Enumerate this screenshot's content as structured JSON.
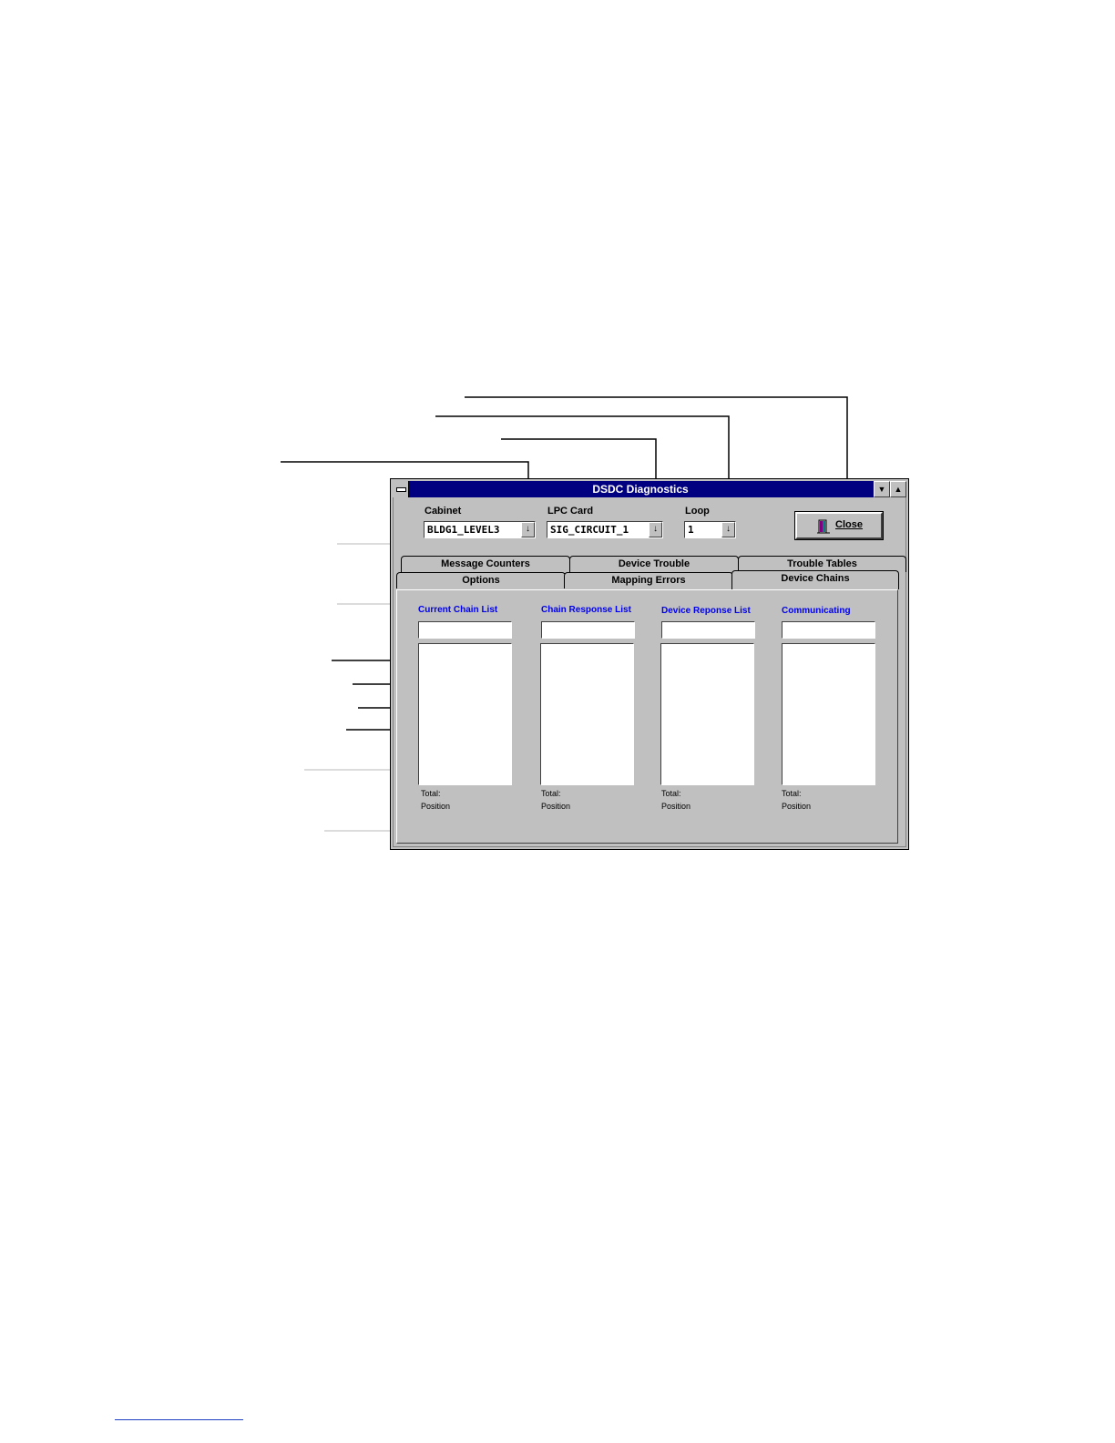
{
  "window": {
    "title": "DSDC Diagnostics",
    "min_glyph": "▼",
    "max_glyph": "▲"
  },
  "selectors": [
    {
      "label": "Cabinet",
      "value": "BLDG1_LEVEL3"
    },
    {
      "label": "LPC Card",
      "value": "SIG_CIRCUIT_1"
    },
    {
      "label": "Loop",
      "value": "1"
    }
  ],
  "dropdown_glyph": "↓",
  "close_button": {
    "label": "Close"
  },
  "tabs": {
    "row1": [
      "Message Counters",
      "Device Trouble",
      "Trouble Tables"
    ],
    "row2": [
      "Options",
      "Mapping Errors",
      "Device Chains"
    ],
    "active": "Device Chains"
  },
  "columns": [
    {
      "header": "Current Chain List",
      "total_label": "Total:",
      "position_label": "Position"
    },
    {
      "header": "Chain Response List",
      "total_label": "Total:",
      "position_label": "Position"
    },
    {
      "header": "Device Reponse List",
      "total_label": "Total:",
      "position_label": "Position"
    },
    {
      "header": "Communicating",
      "total_label": "Total:",
      "position_label": "Position"
    }
  ],
  "colors": {
    "titlebar": "#000080",
    "face": "#c0c0c0",
    "column_header": "#0000ee"
  }
}
